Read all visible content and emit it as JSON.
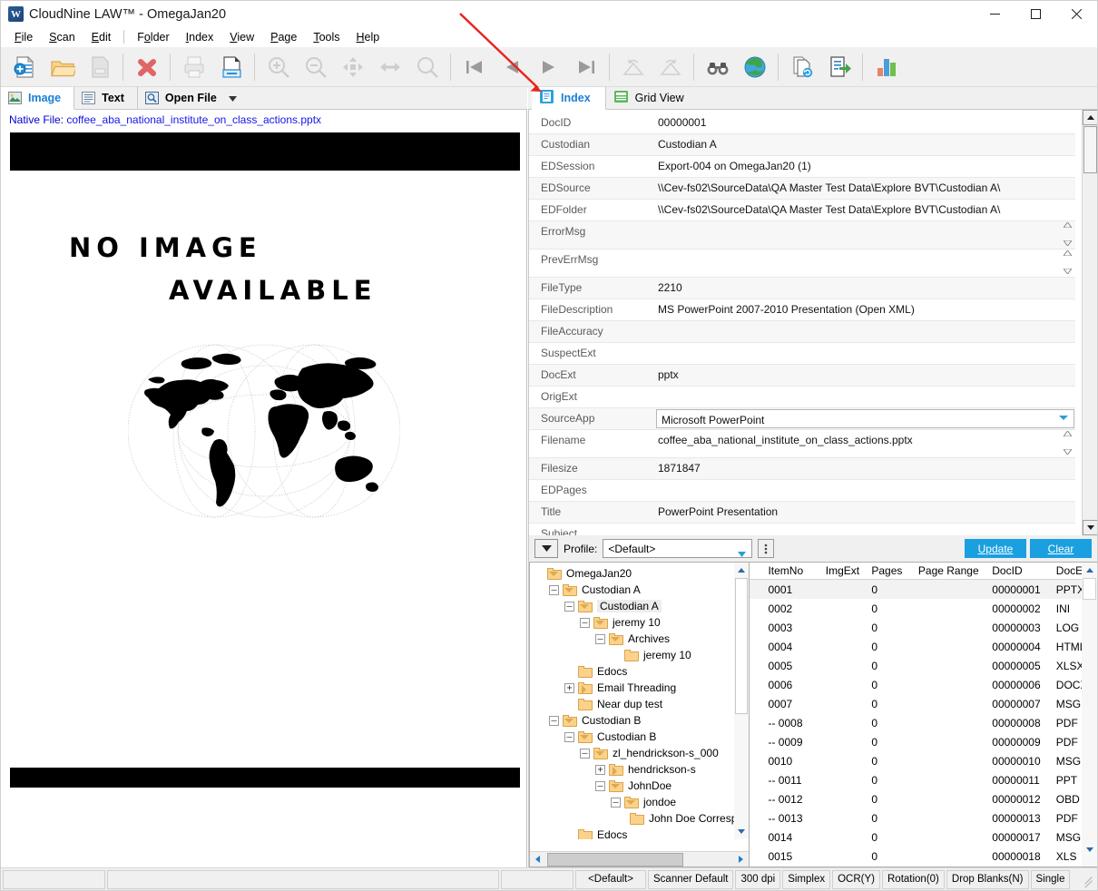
{
  "window": {
    "app_name": "CloudNine LAW™",
    "separator": "-",
    "project": "OmegaJan20",
    "title_full": "CloudNine LAW™  -  OmegaJan20",
    "logo_glyph": "W",
    "minimize": "minimize-icon",
    "maximize": "maximize-icon",
    "close": "close-icon"
  },
  "menu": [
    {
      "label": "File",
      "accel": "F"
    },
    {
      "label": "Scan",
      "accel": "S"
    },
    {
      "label": "Edit",
      "accel": "E"
    },
    {
      "label": "Folder",
      "accel": "o"
    },
    {
      "label": "Index",
      "accel": "I"
    },
    {
      "label": "View",
      "accel": "V"
    },
    {
      "label": "Page",
      "accel": "P"
    },
    {
      "label": "Tools",
      "accel": "T"
    },
    {
      "label": "Help",
      "accel": "H"
    }
  ],
  "toolbar": [
    {
      "name": "new-document-icon",
      "enabled": true
    },
    {
      "name": "open-folder-icon",
      "enabled": true
    },
    {
      "name": "save-document-icon",
      "enabled": false
    },
    {
      "sep": true
    },
    {
      "name": "delete-icon",
      "enabled": true
    },
    {
      "sep": true
    },
    {
      "name": "print-icon",
      "enabled": false
    },
    {
      "name": "print-preview-icon",
      "enabled": true
    },
    {
      "sep": true
    },
    {
      "name": "zoom-in-icon",
      "enabled": false
    },
    {
      "name": "zoom-out-icon",
      "enabled": false
    },
    {
      "name": "pan-icon",
      "enabled": false
    },
    {
      "name": "fit-width-icon",
      "enabled": false
    },
    {
      "name": "zoom-area-icon",
      "enabled": false
    },
    {
      "sep": true
    },
    {
      "name": "first-page-icon",
      "enabled": true
    },
    {
      "name": "previous-page-icon",
      "enabled": true
    },
    {
      "name": "next-page-icon",
      "enabled": true
    },
    {
      "name": "last-page-icon",
      "enabled": true
    },
    {
      "sep": true
    },
    {
      "name": "rotate-left-icon",
      "enabled": false
    },
    {
      "name": "rotate-right-icon",
      "enabled": false
    },
    {
      "sep": true
    },
    {
      "name": "binoculars-icon",
      "enabled": true
    },
    {
      "name": "globe-icon",
      "enabled": true
    },
    {
      "sep": true
    },
    {
      "name": "refresh-document-icon",
      "enabled": true
    },
    {
      "name": "export-icon",
      "enabled": true
    },
    {
      "sep": true
    },
    {
      "name": "chart-icon",
      "enabled": true
    }
  ],
  "viewer": {
    "tabs": [
      {
        "label": "Image",
        "icon": "image-icon",
        "active": true
      },
      {
        "label": "Text",
        "icon": "text-icon",
        "active": false
      },
      {
        "label": "Open File",
        "icon": "open-file-icon",
        "active": false,
        "has_dropdown": true
      }
    ],
    "native_file_label": "Native File:",
    "native_file_name": "coffee_aba_national_institute_on_class_actions.pptx",
    "placeholder_line1": "NO IMAGE",
    "placeholder_line2": "AVAILABLE",
    "placeholder_art": "world-map-globe-graphic"
  },
  "right_panel": {
    "tabs": [
      {
        "label": "Index",
        "icon": "index-icon",
        "active": true
      },
      {
        "label": "Grid View",
        "icon": "grid-view-icon",
        "active": false
      }
    ],
    "fields": [
      {
        "name": "DocID",
        "value": "00000001",
        "type": "text"
      },
      {
        "name": "Custodian",
        "value": "Custodian A",
        "type": "text"
      },
      {
        "name": "EDSession",
        "value": "Export-004 on OmegaJan20 (1)",
        "type": "text"
      },
      {
        "name": "EDSource",
        "value": "\\\\Cev-fs02\\SourceData\\QA Master Test Data\\Explore BVT\\Custodian A\\",
        "type": "text"
      },
      {
        "name": "EDFolder",
        "value": "\\\\Cev-fs02\\SourceData\\QA Master Test Data\\Explore BVT\\Custodian A\\",
        "type": "text"
      },
      {
        "name": "ErrorMsg",
        "value": "",
        "type": "memo"
      },
      {
        "name": "PrevErrMsg",
        "value": "",
        "type": "memo"
      },
      {
        "name": "FileType",
        "value": "2210",
        "type": "text"
      },
      {
        "name": "FileDescription",
        "value": "MS PowerPoint 2007-2010 Presentation (Open XML)",
        "type": "text"
      },
      {
        "name": "FileAccuracy",
        "value": "",
        "type": "text"
      },
      {
        "name": "SuspectExt",
        "value": "",
        "type": "text"
      },
      {
        "name": "DocExt",
        "value": "pptx",
        "type": "text"
      },
      {
        "name": "OrigExt",
        "value": "",
        "type": "text"
      },
      {
        "name": "SourceApp",
        "value": "Microsoft PowerPoint",
        "type": "combo"
      },
      {
        "name": "Filename",
        "value": "coffee_aba_national_institute_on_class_actions.pptx",
        "type": "memo"
      },
      {
        "name": "Filesize",
        "value": "1871847",
        "type": "text"
      },
      {
        "name": "EDPages",
        "value": "",
        "type": "text"
      },
      {
        "name": "Title",
        "value": "PowerPoint Presentation",
        "type": "text"
      },
      {
        "name": "Subject",
        "value": "",
        "type": "text"
      }
    ],
    "profile": {
      "dropdown_icon": "chevron-down-icon",
      "label": "Profile:",
      "value": "<Default>",
      "more_icon": "vertical-ellipsis-icon",
      "update_button": "Update",
      "clear_button": "Clear"
    }
  },
  "tree": {
    "root": "OmegaJan20",
    "nodes": [
      {
        "depth": 0,
        "label": "OmegaJan20",
        "expander": "none",
        "folder": "open",
        "selected": false
      },
      {
        "depth": 1,
        "label": "Custodian A",
        "expander": "minus",
        "folder": "open",
        "selected": false
      },
      {
        "depth": 2,
        "label": "Custodian A",
        "expander": "minus",
        "folder": "open",
        "selected": true
      },
      {
        "depth": 3,
        "label": "jeremy 10",
        "expander": "minus",
        "folder": "open",
        "selected": false
      },
      {
        "depth": 4,
        "label": "Archives",
        "expander": "minus",
        "folder": "open",
        "selected": false
      },
      {
        "depth": 5,
        "label": "jeremy 10",
        "expander": "none",
        "folder": "closed",
        "selected": false
      },
      {
        "depth": 2,
        "label": "Edocs",
        "expander": "none",
        "folder": "closed",
        "selected": false
      },
      {
        "depth": 2,
        "label": "Email Threading",
        "expander": "plus",
        "folder": "right",
        "selected": false
      },
      {
        "depth": 2,
        "label": "Near dup test",
        "expander": "none",
        "folder": "closed",
        "selected": false
      },
      {
        "depth": 1,
        "label": "Custodian B",
        "expander": "minus",
        "folder": "open",
        "selected": false
      },
      {
        "depth": 2,
        "label": "Custodian B",
        "expander": "minus",
        "folder": "open",
        "selected": false
      },
      {
        "depth": 3,
        "label": "zl_hendrickson-s_000",
        "expander": "minus",
        "folder": "open",
        "selected": false
      },
      {
        "depth": 4,
        "label": "hendrickson-s",
        "expander": "plus",
        "folder": "right",
        "selected": false
      },
      {
        "depth": 4,
        "label": "JohnDoe",
        "expander": "minus",
        "folder": "open",
        "selected": false
      },
      {
        "depth": 5,
        "label": "jondoe",
        "expander": "minus",
        "folder": "open",
        "selected": false
      },
      {
        "depth": 6,
        "label": "John Doe Corresp",
        "expander": "none",
        "folder": "closed",
        "selected": false
      },
      {
        "depth": 2,
        "label": "Edocs",
        "expander": "none",
        "folder": "closed",
        "selected": false
      }
    ]
  },
  "grid": {
    "columns": [
      "ItemNo",
      "ImgExt",
      "Pages",
      "Page Range",
      "DocID",
      "DocExt"
    ],
    "rows": [
      {
        "icon": "doc-icon-blue-green",
        "ItemNo": "0001",
        "ImgExt": "",
        "Pages": "0",
        "PageRange": "",
        "DocID": "00000001",
        "DocExt": "PPTX",
        "selected": true
      },
      {
        "icon": "doc-icon-blue-green",
        "ItemNo": "0002",
        "ImgExt": "",
        "Pages": "0",
        "PageRange": "",
        "DocID": "00000002",
        "DocExt": "INI",
        "selected": false
      },
      {
        "icon": "doc-icon-green",
        "ItemNo": "0003",
        "ImgExt": "",
        "Pages": "0",
        "PageRange": "",
        "DocID": "00000003",
        "DocExt": "LOG",
        "selected": false
      },
      {
        "icon": "doc-icon-blue-green",
        "ItemNo": "0004",
        "ImgExt": "",
        "Pages": "0",
        "PageRange": "",
        "DocID": "00000004",
        "DocExt": "HTML",
        "selected": false
      },
      {
        "icon": "doc-icon-blue-green",
        "ItemNo": "0005",
        "ImgExt": "",
        "Pages": "0",
        "PageRange": "",
        "DocID": "00000005",
        "DocExt": "XLSX",
        "selected": false
      },
      {
        "icon": "doc-icon-blue-green",
        "ItemNo": "0006",
        "ImgExt": "",
        "Pages": "0",
        "PageRange": "",
        "DocID": "00000006",
        "DocExt": "DOCX",
        "selected": false
      },
      {
        "icon": "doc-icon-blue-green",
        "ItemNo": "0007",
        "ImgExt": "",
        "Pages": "0",
        "PageRange": "",
        "DocID": "00000007",
        "DocExt": "MSG",
        "selected": false
      },
      {
        "icon": "doc-icon-blue-green",
        "ItemNo": "-- 0008",
        "ImgExt": "",
        "Pages": "0",
        "PageRange": "",
        "DocID": "00000008",
        "DocExt": "PDF",
        "selected": false
      },
      {
        "icon": "doc-icon-blue-green",
        "ItemNo": "-- 0009",
        "ImgExt": "",
        "Pages": "0",
        "PageRange": "",
        "DocID": "00000009",
        "DocExt": "PDF",
        "selected": false
      },
      {
        "icon": "doc-icon-blue-green",
        "ItemNo": "0010",
        "ImgExt": "",
        "Pages": "0",
        "PageRange": "",
        "DocID": "00000010",
        "DocExt": "MSG",
        "selected": false
      },
      {
        "icon": "doc-icon-blue-green",
        "ItemNo": "-- 0011",
        "ImgExt": "",
        "Pages": "0",
        "PageRange": "",
        "DocID": "00000011",
        "DocExt": "PPT",
        "selected": false
      },
      {
        "icon": "doc-icon-none",
        "ItemNo": "-- 0012",
        "ImgExt": "",
        "Pages": "0",
        "PageRange": "",
        "DocID": "00000012",
        "DocExt": "OBD",
        "selected": false
      },
      {
        "icon": "doc-icon-blue-green",
        "ItemNo": "-- 0013",
        "ImgExt": "",
        "Pages": "0",
        "PageRange": "",
        "DocID": "00000013",
        "DocExt": "PDF",
        "selected": false
      },
      {
        "icon": "doc-icon-blue-green",
        "ItemNo": "0014",
        "ImgExt": "",
        "Pages": "0",
        "PageRange": "",
        "DocID": "00000017",
        "DocExt": "MSG",
        "selected": false
      },
      {
        "icon": "doc-icon-green",
        "ItemNo": "0015",
        "ImgExt": "",
        "Pages": "0",
        "PageRange": "",
        "DocID": "00000018",
        "DocExt": "XLS",
        "selected": false
      }
    ]
  },
  "statusbar": {
    "cells": [
      {
        "name": "status-left",
        "text": ""
      },
      {
        "name": "status-message",
        "text": ""
      },
      {
        "name": "status-spacer",
        "text": ""
      },
      {
        "name": "status-profile",
        "text": "<Default>"
      },
      {
        "name": "status-scanner",
        "text": "Scanner Default"
      },
      {
        "name": "status-dpi",
        "text": "300 dpi"
      },
      {
        "name": "status-duplex",
        "text": "Simplex"
      },
      {
        "name": "status-ocr",
        "text": "OCR(Y)"
      },
      {
        "name": "status-rotation",
        "text": "Rotation(0)"
      },
      {
        "name": "status-blanks",
        "text": "Drop Blanks(N)"
      },
      {
        "name": "status-pagemode",
        "text": "Single"
      }
    ]
  },
  "annotation": {
    "arrow": "red-arrow-pointing-to-index-tab",
    "color": "#e8231e"
  }
}
